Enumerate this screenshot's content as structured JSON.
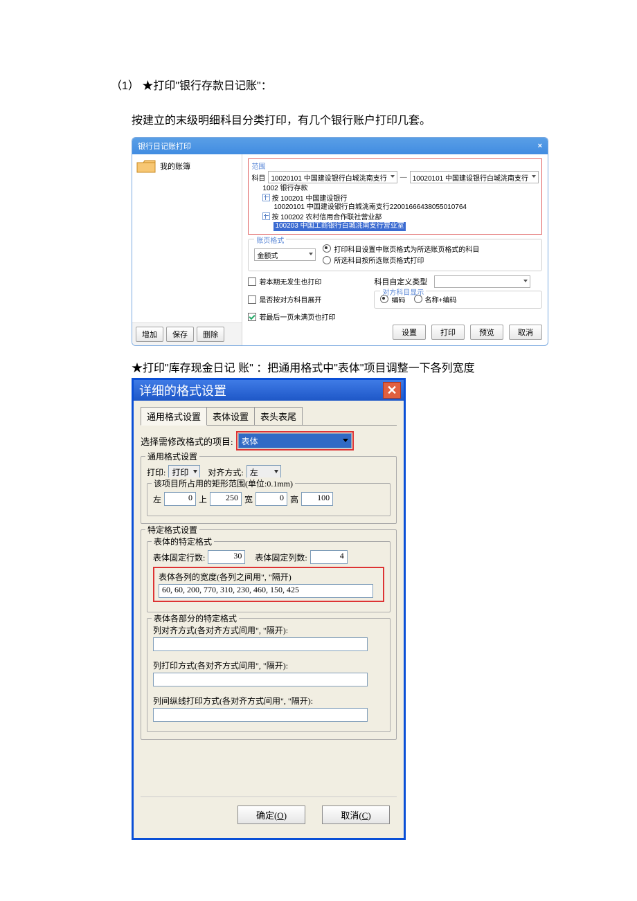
{
  "intro": {
    "line1": "（1） ★打印\"银行存款日记账\"：",
    "line2": "按建立的末级明细科目分类打印，有几个银行账户打印几套。",
    "line3": "★打印\"库存现金日记 账\" ：把通用格式中\"表体\"项目调整一下各列宽度"
  },
  "dlg1": {
    "title": "银行日记账打印",
    "close": "×",
    "my_book": "我的账簿",
    "btn_add": "增加",
    "btn_save": "保存",
    "btn_del": "删除",
    "group_range": "范围",
    "subject_label": "科目",
    "subject_from": "10020101 中国建设银行白城洮南支行",
    "subject_to": "10020101 中国建设银行白城洮南支行",
    "dash": "—",
    "tree": {
      "n1": "1002 银行存款",
      "n2": "100201 中国建设银行",
      "n3": "10020101 中国建设银行白城洮南支行22001666438055010764",
      "n4": "100202 农村信用合作联社营业部",
      "n5": "100203 中国工商银行白城洮南支行营业室"
    },
    "exp_prefix": "按",
    "group_pagefmt": "账页格式",
    "amount_style": "金额式",
    "opt_fmt1": "打印科目设置中账页格式为所选账页格式的科目",
    "opt_fmt2": "所选科目按所选账页格式打印",
    "chk1": "若本期无发生也打印",
    "chk2": "是否按对方科目展开",
    "chk3": "若最后一页未满页也打印",
    "custom_type_label": "科目自定义类型",
    "opposite_group": "对方科目显示",
    "opp_code": "编码",
    "opp_namecode": "名称+编码",
    "btn_set": "设置",
    "btn_print": "打印",
    "btn_preview": "预览",
    "btn_cancel": "取消"
  },
  "dlg2": {
    "title": "详细的格式设置",
    "tabs": {
      "t1": "通用格式设置",
      "t2": "表体设置",
      "t3": "表头表尾"
    },
    "row1_label": "选择需修改格式的项目:",
    "row1_value": "表体",
    "general_group": "通用格式设置",
    "print_label": "打印:",
    "print_value": "打印",
    "align_label": "对齐方式:",
    "align_value": "左",
    "rect_group": "该项目所占用的矩形范围(单位:0.1mm)",
    "left_lbl": "左",
    "left_v": "0",
    "top_lbl": "上",
    "top_v": "250",
    "width_lbl": "宽",
    "width_v": "0",
    "height_lbl": "高",
    "height_v": "100",
    "spec_group": "特定格式设置",
    "body_group": "表体的特定格式",
    "fix_rows_lbl": "表体固定行数:",
    "fix_rows_v": "30",
    "fix_cols_lbl": "表体固定列数:",
    "fix_cols_v": "4",
    "col_widths_lbl": "表体各列的宽度(各列之间用\", \"隔开)",
    "col_widths_v": "60, 60, 200, 770, 310, 230, 460, 150, 425",
    "parts_group": "表体各部分的特定格式",
    "col_align_lbl": "列对齐方式(各对齐方式间用\", \"隔开):",
    "col_print_lbl": "列打印方式(各对齐方式间用\", \"隔开):",
    "col_vline_lbl": "列间纵线打印方式(各对齐方式间用\", \"隔开):",
    "ok": "确定(O)",
    "cancel": "取消(C)"
  }
}
